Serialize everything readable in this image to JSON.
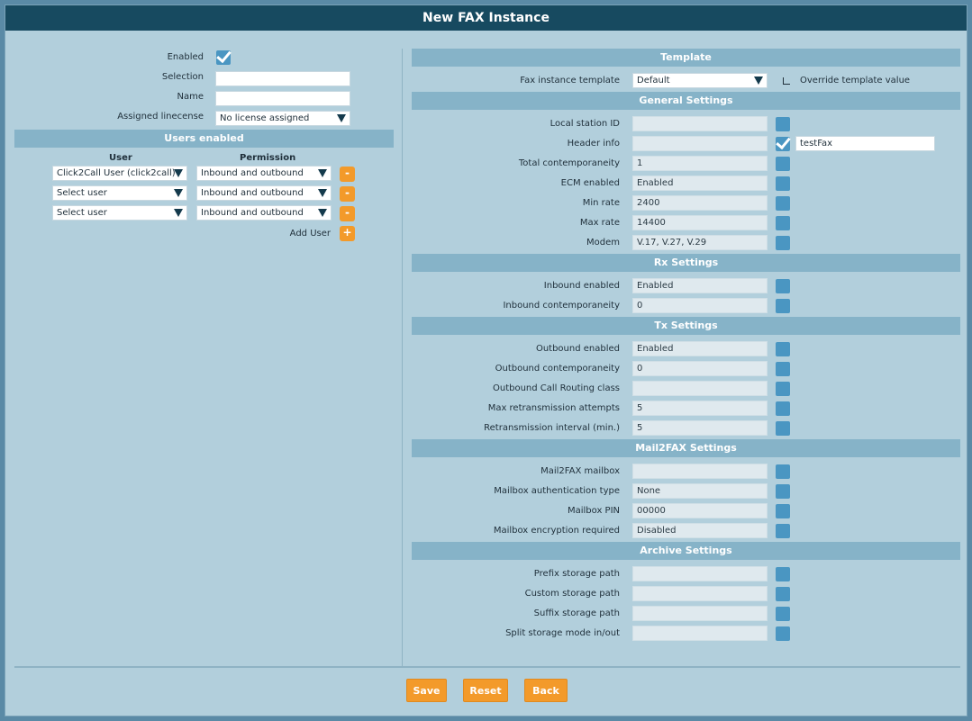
{
  "window": {
    "title": "New FAX Instance"
  },
  "left": {
    "fields": {
      "enabled": {
        "label": "Enabled",
        "checked": true
      },
      "selection": {
        "label": "Selection",
        "value": ""
      },
      "name": {
        "label": "Name",
        "value": ""
      },
      "license": {
        "label": "Assigned linecense",
        "value": "No license assigned"
      }
    },
    "users_section": {
      "title": "Users enabled",
      "col_user": "User",
      "col_permission": "Permission",
      "rows": [
        {
          "user": "Click2Call User (click2call)",
          "permission": "Inbound and outbound",
          "action": "-"
        },
        {
          "user": "Select user",
          "permission": "Inbound and outbound",
          "action": "-"
        },
        {
          "user": "Select user",
          "permission": "Inbound and outbound",
          "action": "-"
        }
      ],
      "add_label": "Add User",
      "add_action": "+"
    }
  },
  "right": {
    "template": {
      "title": "Template",
      "label": "Fax instance template",
      "value": "Default",
      "override_label": "Override template value"
    },
    "general": {
      "title": "General Settings",
      "rows": [
        {
          "label": "Local station ID",
          "value": "",
          "override": false
        },
        {
          "label": "Header info",
          "value": "",
          "override": true,
          "override_value": "testFax"
        },
        {
          "label": "Total contemporaneity",
          "value": "1",
          "override": false
        },
        {
          "label": "ECM enabled",
          "value": "Enabled",
          "override": false
        },
        {
          "label": "Min rate",
          "value": "2400",
          "override": false
        },
        {
          "label": "Max rate",
          "value": "14400",
          "override": false
        },
        {
          "label": "Modem",
          "value": "V.17, V.27, V.29",
          "override": false
        }
      ]
    },
    "rx": {
      "title": "Rx Settings",
      "rows": [
        {
          "label": "Inbound enabled",
          "value": "Enabled",
          "override": false
        },
        {
          "label": "Inbound contemporaneity",
          "value": "0",
          "override": false
        }
      ]
    },
    "tx": {
      "title": "Tx Settings",
      "rows": [
        {
          "label": "Outbound enabled",
          "value": "Enabled",
          "override": false
        },
        {
          "label": "Outbound contemporaneity",
          "value": "0",
          "override": false
        },
        {
          "label": "Outbound Call Routing class",
          "value": "",
          "override": false
        },
        {
          "label": "Max retransmission attempts",
          "value": "5",
          "override": false
        },
        {
          "label": "Retransmission interval (min.)",
          "value": "5",
          "override": false
        }
      ]
    },
    "mail2fax": {
      "title": "Mail2FAX Settings",
      "rows": [
        {
          "label": "Mail2FAX mailbox",
          "value": "",
          "override": false
        },
        {
          "label": "Mailbox authentication type",
          "value": "None",
          "override": false
        },
        {
          "label": "Mailbox PIN",
          "value": "00000",
          "override": false
        },
        {
          "label": "Mailbox encryption required",
          "value": "Disabled",
          "override": false
        }
      ]
    },
    "archive": {
      "title": "Archive Settings",
      "rows": [
        {
          "label": "Prefix storage path",
          "value": "",
          "override": false
        },
        {
          "label": "Custom storage path",
          "value": "",
          "override": false
        },
        {
          "label": "Suffix storage path",
          "value": "",
          "override": false
        },
        {
          "label": "Split storage mode in/out",
          "value": "",
          "override": false
        }
      ]
    }
  },
  "footer": {
    "save": "Save",
    "reset": "Reset",
    "back": "Back"
  },
  "colors": {
    "header": "#174a60",
    "section": "#86b3c8",
    "panel": "#b2cfdc",
    "accent": "#f39a2a",
    "checkbox": "#4a96c2"
  },
  "icons": {
    "checkbox_checked": "checkmark-icon",
    "dropdown": "chevron-down-icon",
    "override": "corner-arrow-icon"
  }
}
